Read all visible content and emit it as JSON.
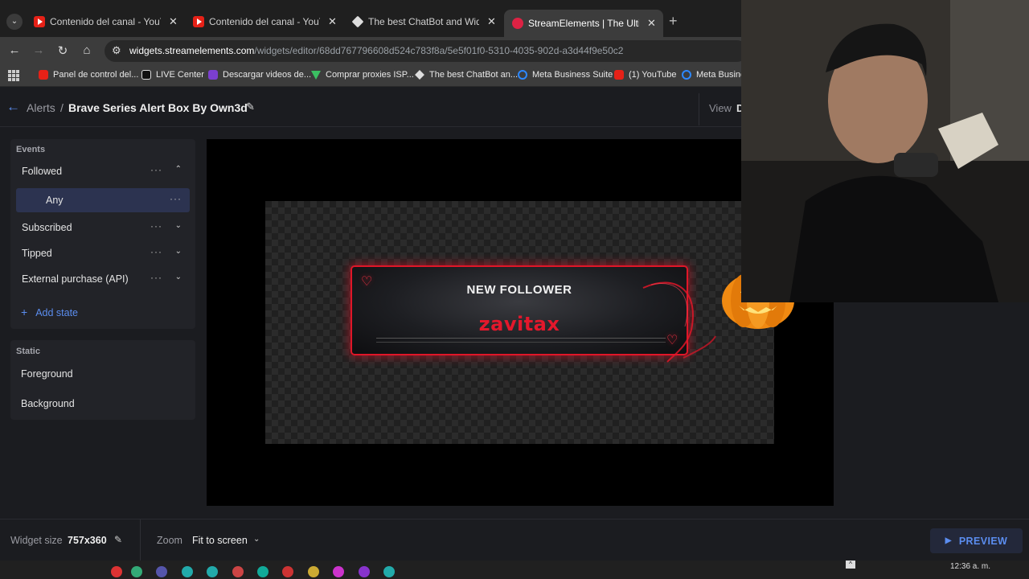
{
  "browser": {
    "tabs": [
      {
        "title": "Contenido del canal - YouTube",
        "icon": "youtube-icon"
      },
      {
        "title": "Contenido del canal - YouTube",
        "icon": "youtube-icon"
      },
      {
        "title": "The best ChatBot and Widgets",
        "icon": "streamelements-diamond-icon"
      },
      {
        "title": "StreamElements | The Ultimate",
        "icon": "streamelements-icon",
        "active": true
      }
    ],
    "url_host": "widgets.streamelements.com",
    "url_path": "/widgets/editor/68dd767796608d524c783f8a/5e5f01f0-5310-4035-902d-a3d44f9e50c2",
    "bookmarks": [
      {
        "label": "Panel de control del...",
        "icon": "youtube-icon"
      },
      {
        "label": "LIVE Center",
        "icon": "tiktok-icon"
      },
      {
        "label": "Descargar videos de...",
        "icon": "download-icon"
      },
      {
        "label": "Comprar proxies ISP...",
        "icon": "vue-icon"
      },
      {
        "label": "The best ChatBot an...",
        "icon": "streamelements-diamond-icon"
      },
      {
        "label": "Meta Business Suite",
        "icon": "meta-icon"
      },
      {
        "label": "(1) YouTube",
        "icon": "youtube-icon"
      },
      {
        "label": "Meta Busine",
        "icon": "meta-icon"
      }
    ]
  },
  "header": {
    "breadcrumb_parent": "Alerts",
    "breadcrumb_sep": "/",
    "title": "Brave Series Alert Box By Own3d",
    "view_label": "View",
    "view_value": "D"
  },
  "sidebar": {
    "events_title": "Events",
    "events": [
      {
        "label": "Followed",
        "dots": "···",
        "chevron": "⌃"
      },
      {
        "label": "Any",
        "dots": "···",
        "selected": true
      },
      {
        "label": "Subscribed",
        "dots": "···",
        "chevron": "⌄"
      },
      {
        "label": "Tipped",
        "dots": "···",
        "chevron": "⌄"
      },
      {
        "label": "External purchase (API)",
        "dots": "···",
        "chevron": "⌄"
      }
    ],
    "add_state": "Add state",
    "static_title": "Static",
    "static_items": [
      "Foreground",
      "Background"
    ]
  },
  "alert_preview": {
    "title": "NEW FOLLOWER",
    "name": "zavitax",
    "accent": "#e01628"
  },
  "footer": {
    "widget_size_label": "Widget size",
    "widget_size_value": "757x360",
    "zoom_label": "Zoom",
    "zoom_value": "Fit to screen",
    "preview_label": "PREVIEW"
  },
  "taskbar": {
    "time": "12:36 a. m."
  },
  "colors": {
    "accent_blue": "#5b8def",
    "panel_bg": "#222328",
    "app_bg": "#1b1c20",
    "selected_row": "#2c3350"
  }
}
